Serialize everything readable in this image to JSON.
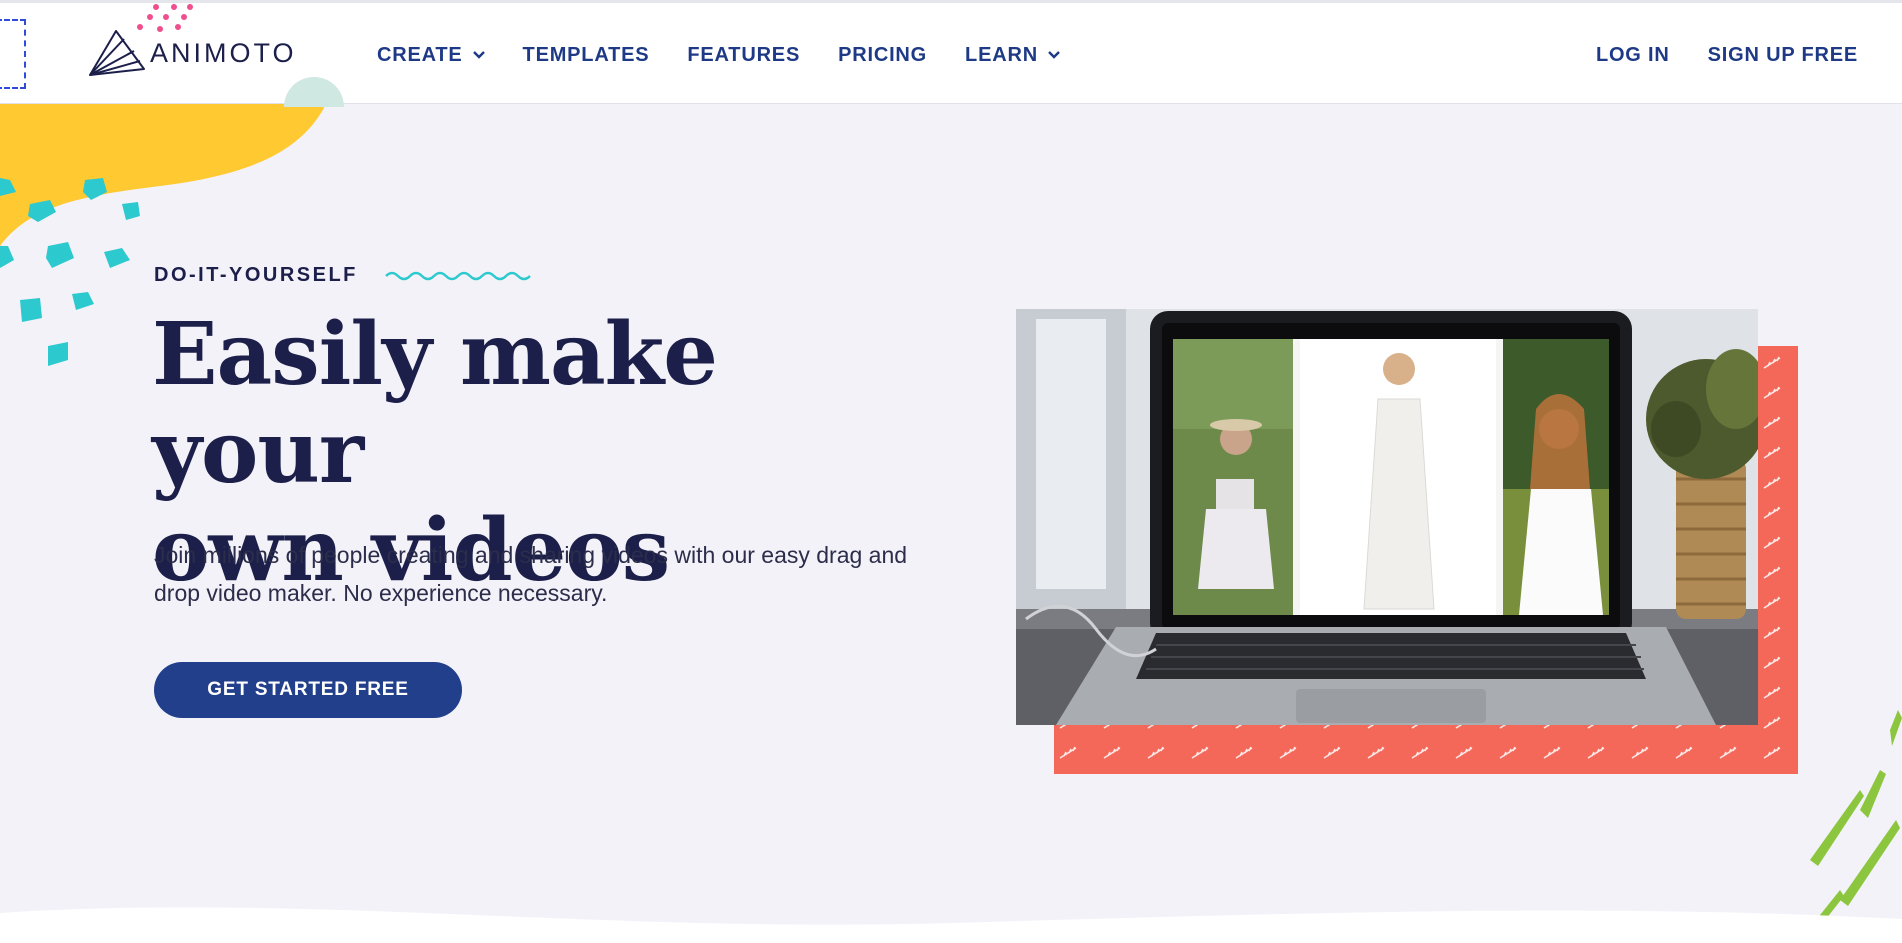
{
  "brand": {
    "name": "ANIMOTO"
  },
  "nav": {
    "items": [
      {
        "label": "CREATE",
        "has_dropdown": true
      },
      {
        "label": "TEMPLATES",
        "has_dropdown": false
      },
      {
        "label": "FEATURES",
        "has_dropdown": false
      },
      {
        "label": "PRICING",
        "has_dropdown": false
      },
      {
        "label": "LEARN",
        "has_dropdown": true
      }
    ],
    "login_label": "LOG IN",
    "signup_label": "SIGN UP FREE"
  },
  "hero": {
    "eyebrow": "DO-IT-YOURSELF",
    "title_line1": "Easily make your",
    "title_line2": "own videos",
    "subtitle": "Join millions of people creating and sharing videos with our easy drag and drop video maker. No experience necessary.",
    "cta_label": "GET STARTED FREE"
  },
  "icons": {
    "logo": "animoto-fan-logo-icon",
    "chevron": "chevron-down-icon",
    "wave": "squiggle-wave-icon"
  },
  "colors": {
    "navy": "#1c1f4a",
    "nav_blue": "#1e3a86",
    "cta_blue": "#223f8b",
    "yellow": "#ffc931",
    "teal": "#2cc9cf",
    "coral": "#f4685a",
    "green": "#8cc63f",
    "pink": "#ef4f8d",
    "background": "#f3f2f8"
  }
}
